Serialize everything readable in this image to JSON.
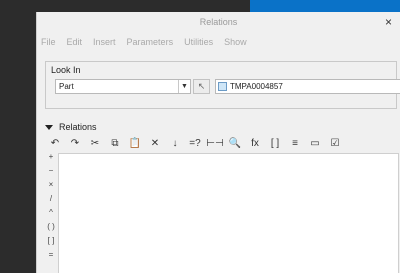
{
  "window": {
    "title": "Relations"
  },
  "menu": [
    "File",
    "Edit",
    "Insert",
    "Parameters",
    "Utilities",
    "Show"
  ],
  "look_in": {
    "label": "Look In",
    "type_value": "Part",
    "model_name": "TMPA0004857"
  },
  "relations": {
    "label": "Relations",
    "operators": [
      "+",
      "−",
      "×",
      "/",
      "^",
      "( )",
      "[ ]",
      "="
    ],
    "toolbar": [
      {
        "name": "undo-icon",
        "glyph": "↶"
      },
      {
        "name": "redo-icon",
        "glyph": "↷"
      },
      {
        "name": "cut-icon",
        "glyph": "✂"
      },
      {
        "name": "copy-icon",
        "glyph": "⧉"
      },
      {
        "name": "paste-icon",
        "glyph": "📋"
      },
      {
        "name": "delete-icon",
        "glyph": "✕"
      },
      {
        "name": "sort-icon",
        "glyph": "↓"
      },
      {
        "name": "evaluate-icon",
        "glyph": "=?"
      },
      {
        "name": "measure-icon",
        "glyph": "⊢⊣"
      },
      {
        "name": "show-dimensions-icon",
        "glyph": "🔍"
      },
      {
        "name": "insert-function-icon",
        "glyph": "fx"
      },
      {
        "name": "insert-parameter-icon",
        "glyph": "[ ]"
      },
      {
        "name": "sort-relations-icon",
        "glyph": "≡"
      },
      {
        "name": "display-icon",
        "glyph": "▭"
      },
      {
        "name": "verify-icon",
        "glyph": "☑"
      }
    ]
  }
}
